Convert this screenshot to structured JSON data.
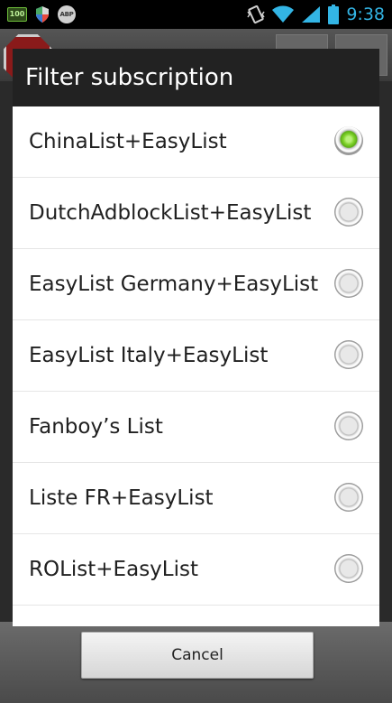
{
  "status_bar": {
    "battery_notification_label": "100",
    "abp_label": "ABP",
    "time": "9:38",
    "icons": [
      "battery-notification-icon",
      "shield-icon",
      "abp-icon",
      "vibrate-icon",
      "wifi-icon",
      "signal-icon",
      "battery-icon"
    ]
  },
  "dialog": {
    "title": "Filter subscription",
    "options": [
      {
        "label": "ChinaList+EasyList",
        "selected": true
      },
      {
        "label": "DutchAdblockList+EasyList",
        "selected": false
      },
      {
        "label": "EasyList Germany+EasyList",
        "selected": false
      },
      {
        "label": "EasyList Italy+EasyList",
        "selected": false
      },
      {
        "label": "Fanboy’s List",
        "selected": false
      },
      {
        "label": "Liste FR+EasyList",
        "selected": false
      },
      {
        "label": "ROList+EasyList",
        "selected": false
      }
    ],
    "cancel_label": "Cancel"
  },
  "colors": {
    "accent_clock": "#33b5e5",
    "radio_checked": "#7fd22a",
    "title_bar": "#222222"
  }
}
